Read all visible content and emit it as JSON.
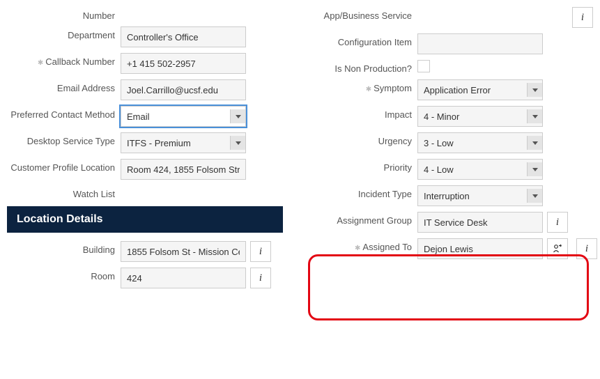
{
  "left": {
    "number_label": "Number",
    "department_label": "Department",
    "department": "Controller's Office",
    "callback_label": "Callback Number",
    "callback": "+1 415 502-2957",
    "email_label": "Email Address",
    "email": "Joel.Carrillo@ucsf.edu",
    "pcm_label": "Preferred Contact Method",
    "pcm": "Email",
    "dst_label": "Desktop Service Type",
    "dst": "ITFS - Premium",
    "cpl_label": "Customer Profile Location",
    "cpl": "Room 424, 1855 Folsom Str",
    "watch_label": "Watch List"
  },
  "location": {
    "header": "Location Details",
    "building_label": "Building",
    "building": "1855 Folsom St - Mission Ce",
    "room_label": "Room",
    "room": "424"
  },
  "right": {
    "abs_label": "App/Business Service",
    "ci_label": "Configuration Item",
    "nonprod_label": "Is Non Production?",
    "symptom_label": "Symptom",
    "symptom": "Application Error",
    "impact_label": "Impact",
    "impact": "4 - Minor",
    "urgency_label": "Urgency",
    "urgency": "3 - Low",
    "priority_label": "Priority",
    "priority": "4 - Low",
    "itype_label": "Incident Type",
    "itype": "Interruption",
    "agroup_label": "Assignment Group",
    "agroup": "IT Service Desk",
    "assigned_label": "Assigned To",
    "assigned": "Dejon Lewis"
  }
}
